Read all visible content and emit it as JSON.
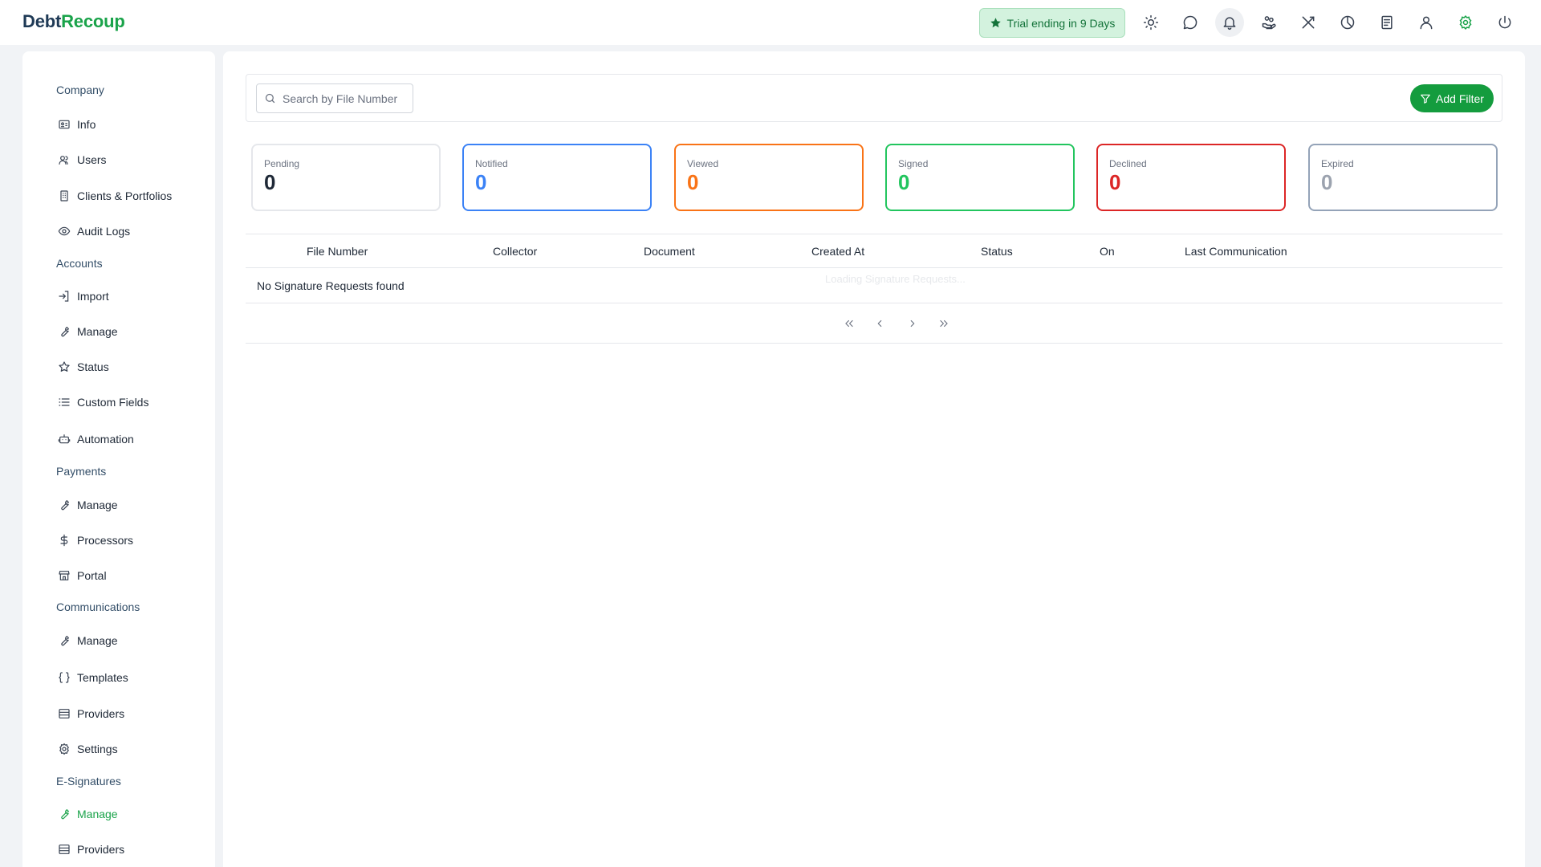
{
  "brand": {
    "part1": "Debt",
    "part2": "Recoup"
  },
  "trial": {
    "label": "Trial ending in 9 Days"
  },
  "topbar_icons": [
    "sun-icon",
    "chat-icon",
    "bell-icon",
    "hand-coins-icon",
    "tools-icon",
    "pie-chart-icon",
    "document-icon",
    "user-icon",
    "gear-icon",
    "power-icon"
  ],
  "sidebar": {
    "sections": {
      "company": "Company",
      "accounts": "Accounts",
      "payments": "Payments",
      "communications": "Communications",
      "esignatures": "E-Signatures"
    },
    "items": {
      "info": "Info",
      "users": "Users",
      "clients": "Clients & Portfolios",
      "audit": "Audit Logs",
      "import": "Import",
      "acc_manage": "Manage",
      "status": "Status",
      "custom_fields": "Custom Fields",
      "automation": "Automation",
      "pay_manage": "Manage",
      "processors": "Processors",
      "portal": "Portal",
      "comm_manage": "Manage",
      "templates": "Templates",
      "comm_providers": "Providers",
      "settings": "Settings",
      "esig_manage": "Manage",
      "esig_providers": "Providers"
    }
  },
  "search": {
    "placeholder": "Search by File Number"
  },
  "filter": {
    "label": "Add Filter"
  },
  "cards": [
    {
      "label": "Pending",
      "value": "0",
      "color": "#1f2937",
      "border": "#e5e7eb"
    },
    {
      "label": "Notified",
      "value": "0",
      "color": "#3b82f6",
      "border": "#3b82f6"
    },
    {
      "label": "Viewed",
      "value": "0",
      "color": "#f97316",
      "border": "#f97316"
    },
    {
      "label": "Signed",
      "value": "0",
      "color": "#22c55e",
      "border": "#22c55e"
    },
    {
      "label": "Declined",
      "value": "0",
      "color": "#dc2626",
      "border": "#dc2626"
    },
    {
      "label": "Expired",
      "value": "0",
      "color": "#9ca3af",
      "border": "#94a3b8"
    }
  ],
  "table": {
    "columns": {
      "file_number": "File Number",
      "collector": "Collector",
      "document": "Document",
      "created_at": "Created At",
      "status": "Status",
      "on": "On",
      "last_comm": "Last Communication"
    },
    "empty": "No Signature Requests found",
    "loading": "Loading Signature Requests..."
  }
}
